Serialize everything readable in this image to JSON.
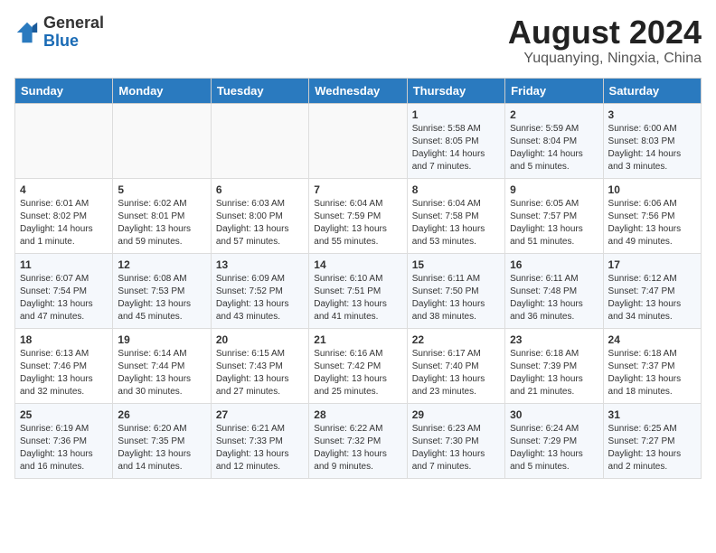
{
  "header": {
    "logo_general": "General",
    "logo_blue": "Blue",
    "title": "August 2024",
    "location": "Yuquanying, Ningxia, China"
  },
  "days_of_week": [
    "Sunday",
    "Monday",
    "Tuesday",
    "Wednesday",
    "Thursday",
    "Friday",
    "Saturday"
  ],
  "weeks": [
    [
      {
        "day": "",
        "info": ""
      },
      {
        "day": "",
        "info": ""
      },
      {
        "day": "",
        "info": ""
      },
      {
        "day": "",
        "info": ""
      },
      {
        "day": "1",
        "info": "Sunrise: 5:58 AM\nSunset: 8:05 PM\nDaylight: 14 hours\nand 7 minutes."
      },
      {
        "day": "2",
        "info": "Sunrise: 5:59 AM\nSunset: 8:04 PM\nDaylight: 14 hours\nand 5 minutes."
      },
      {
        "day": "3",
        "info": "Sunrise: 6:00 AM\nSunset: 8:03 PM\nDaylight: 14 hours\nand 3 minutes."
      }
    ],
    [
      {
        "day": "4",
        "info": "Sunrise: 6:01 AM\nSunset: 8:02 PM\nDaylight: 14 hours\nand 1 minute."
      },
      {
        "day": "5",
        "info": "Sunrise: 6:02 AM\nSunset: 8:01 PM\nDaylight: 13 hours\nand 59 minutes."
      },
      {
        "day": "6",
        "info": "Sunrise: 6:03 AM\nSunset: 8:00 PM\nDaylight: 13 hours\nand 57 minutes."
      },
      {
        "day": "7",
        "info": "Sunrise: 6:04 AM\nSunset: 7:59 PM\nDaylight: 13 hours\nand 55 minutes."
      },
      {
        "day": "8",
        "info": "Sunrise: 6:04 AM\nSunset: 7:58 PM\nDaylight: 13 hours\nand 53 minutes."
      },
      {
        "day": "9",
        "info": "Sunrise: 6:05 AM\nSunset: 7:57 PM\nDaylight: 13 hours\nand 51 minutes."
      },
      {
        "day": "10",
        "info": "Sunrise: 6:06 AM\nSunset: 7:56 PM\nDaylight: 13 hours\nand 49 minutes."
      }
    ],
    [
      {
        "day": "11",
        "info": "Sunrise: 6:07 AM\nSunset: 7:54 PM\nDaylight: 13 hours\nand 47 minutes."
      },
      {
        "day": "12",
        "info": "Sunrise: 6:08 AM\nSunset: 7:53 PM\nDaylight: 13 hours\nand 45 minutes."
      },
      {
        "day": "13",
        "info": "Sunrise: 6:09 AM\nSunset: 7:52 PM\nDaylight: 13 hours\nand 43 minutes."
      },
      {
        "day": "14",
        "info": "Sunrise: 6:10 AM\nSunset: 7:51 PM\nDaylight: 13 hours\nand 41 minutes."
      },
      {
        "day": "15",
        "info": "Sunrise: 6:11 AM\nSunset: 7:50 PM\nDaylight: 13 hours\nand 38 minutes."
      },
      {
        "day": "16",
        "info": "Sunrise: 6:11 AM\nSunset: 7:48 PM\nDaylight: 13 hours\nand 36 minutes."
      },
      {
        "day": "17",
        "info": "Sunrise: 6:12 AM\nSunset: 7:47 PM\nDaylight: 13 hours\nand 34 minutes."
      }
    ],
    [
      {
        "day": "18",
        "info": "Sunrise: 6:13 AM\nSunset: 7:46 PM\nDaylight: 13 hours\nand 32 minutes."
      },
      {
        "day": "19",
        "info": "Sunrise: 6:14 AM\nSunset: 7:44 PM\nDaylight: 13 hours\nand 30 minutes."
      },
      {
        "day": "20",
        "info": "Sunrise: 6:15 AM\nSunset: 7:43 PM\nDaylight: 13 hours\nand 27 minutes."
      },
      {
        "day": "21",
        "info": "Sunrise: 6:16 AM\nSunset: 7:42 PM\nDaylight: 13 hours\nand 25 minutes."
      },
      {
        "day": "22",
        "info": "Sunrise: 6:17 AM\nSunset: 7:40 PM\nDaylight: 13 hours\nand 23 minutes."
      },
      {
        "day": "23",
        "info": "Sunrise: 6:18 AM\nSunset: 7:39 PM\nDaylight: 13 hours\nand 21 minutes."
      },
      {
        "day": "24",
        "info": "Sunrise: 6:18 AM\nSunset: 7:37 PM\nDaylight: 13 hours\nand 18 minutes."
      }
    ],
    [
      {
        "day": "25",
        "info": "Sunrise: 6:19 AM\nSunset: 7:36 PM\nDaylight: 13 hours\nand 16 minutes."
      },
      {
        "day": "26",
        "info": "Sunrise: 6:20 AM\nSunset: 7:35 PM\nDaylight: 13 hours\nand 14 minutes."
      },
      {
        "day": "27",
        "info": "Sunrise: 6:21 AM\nSunset: 7:33 PM\nDaylight: 13 hours\nand 12 minutes."
      },
      {
        "day": "28",
        "info": "Sunrise: 6:22 AM\nSunset: 7:32 PM\nDaylight: 13 hours\nand 9 minutes."
      },
      {
        "day": "29",
        "info": "Sunrise: 6:23 AM\nSunset: 7:30 PM\nDaylight: 13 hours\nand 7 minutes."
      },
      {
        "day": "30",
        "info": "Sunrise: 6:24 AM\nSunset: 7:29 PM\nDaylight: 13 hours\nand 5 minutes."
      },
      {
        "day": "31",
        "info": "Sunrise: 6:25 AM\nSunset: 7:27 PM\nDaylight: 13 hours\nand 2 minutes."
      }
    ]
  ]
}
